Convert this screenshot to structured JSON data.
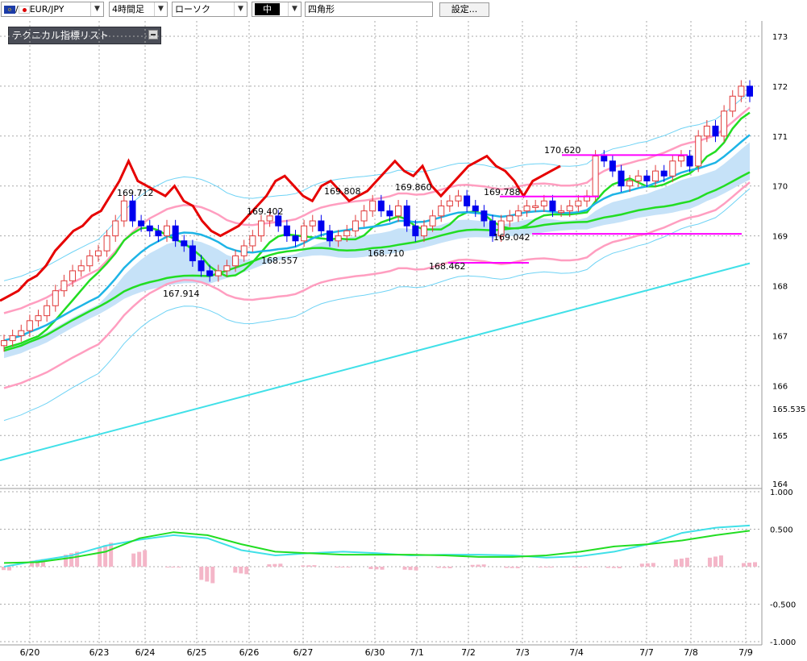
{
  "toolbar": {
    "symbol": "EUR/JPY",
    "timeframe": "4時間足",
    "chart_style": "ローソク",
    "thickness": "中",
    "draw_shape": "四角形",
    "settings_label": "設定..."
  },
  "indicator_panel": {
    "title": "テクニカル指標リスト"
  },
  "price_axis": {
    "labels": [
      "173",
      "172",
      "171",
      "170",
      "169",
      "168",
      "167",
      "166",
      "165.535",
      "165",
      "164"
    ]
  },
  "osc_axis": {
    "labels": [
      "1.000",
      "0.500",
      "-0.500",
      "-1.000"
    ]
  },
  "date_axis": {
    "labels": [
      "6/20",
      "6/23",
      "6/24",
      "6/25",
      "6/26",
      "6/27",
      "6/30",
      "7/1",
      "7/2",
      "7/3",
      "7/4",
      "7/7",
      "7/8",
      "7/9"
    ]
  },
  "annotations": [
    {
      "text": "169.712"
    },
    {
      "text": "169.402"
    },
    {
      "text": "169.808"
    },
    {
      "text": "169.860"
    },
    {
      "text": "169.788"
    },
    {
      "text": "170.620"
    },
    {
      "text": "167.914"
    },
    {
      "text": "168.557"
    },
    {
      "text": "168.710"
    },
    {
      "text": "168.462"
    },
    {
      "text": "169.042"
    }
  ],
  "colors": {
    "up_candle": "#e03a3a",
    "down_candle": "#0000ee",
    "red_line": "#e60000",
    "green_line": "#22dd22",
    "blue_line": "#1eb4e6",
    "pink_line": "#ff9ec0",
    "cyan_line": "#40e0e8",
    "cloud": "#c6e2f8",
    "magenta_line": "#ff00ff",
    "histogram": "#f4b6c8"
  },
  "chart_data": {
    "type": "candlestick",
    "title": "EUR/JPY 4時間足",
    "x_labels": [
      "6/20",
      "6/23",
      "6/24",
      "6/25",
      "6/26",
      "6/27",
      "6/30",
      "7/1",
      "7/2",
      "7/3",
      "7/4",
      "7/7",
      "7/8",
      "7/9"
    ],
    "ylim": [
      164,
      173
    ],
    "closes": [
      166.9,
      167.0,
      167.1,
      167.3,
      167.4,
      167.6,
      167.9,
      168.1,
      168.3,
      168.4,
      168.6,
      168.7,
      169.0,
      169.3,
      169.7,
      169.3,
      169.2,
      169.1,
      169.0,
      169.2,
      168.9,
      168.8,
      168.5,
      168.3,
      168.2,
      168.3,
      168.4,
      168.6,
      168.8,
      169.0,
      169.3,
      169.4,
      169.2,
      169.0,
      168.9,
      169.2,
      169.3,
      169.1,
      168.9,
      169.0,
      169.1,
      169.3,
      169.5,
      169.7,
      169.5,
      169.4,
      169.6,
      169.2,
      169.0,
      169.2,
      169.4,
      169.6,
      169.7,
      169.8,
      169.6,
      169.5,
      169.3,
      169.0,
      169.3,
      169.4,
      169.5,
      169.6,
      169.6,
      169.7,
      169.5,
      169.5,
      169.6,
      169.7,
      169.8,
      170.6,
      170.5,
      170.3,
      170.0,
      170.1,
      170.2,
      170.1,
      170.3,
      170.2,
      170.5,
      170.6,
      170.4,
      171.0,
      171.2,
      171.0,
      171.5,
      171.8,
      172.0,
      171.8
    ],
    "series": [
      {
        "name": "oscillator_line_1",
        "values": [
          0.0,
          0.08,
          0.15,
          0.28,
          0.36,
          0.42,
          0.38,
          0.22,
          0.15,
          0.18,
          0.2,
          0.18,
          0.15,
          0.16,
          0.16,
          0.15,
          0.12,
          0.14,
          0.2,
          0.3,
          0.45,
          0.52,
          0.55
        ]
      },
      {
        "name": "oscillator_line_2",
        "values": [
          0.05,
          0.06,
          0.12,
          0.2,
          0.38,
          0.46,
          0.42,
          0.3,
          0.2,
          0.18,
          0.16,
          0.16,
          0.16,
          0.15,
          0.13,
          0.13,
          0.15,
          0.2,
          0.27,
          0.3,
          0.35,
          0.42,
          0.48
        ]
      },
      {
        "name": "oscillator_histogram",
        "values": [
          -0.05,
          0.1,
          0.2,
          0.32,
          0.22,
          0.0,
          -0.22,
          -0.1,
          0.04,
          0.02,
          0.0,
          -0.04,
          -0.05,
          -0.02,
          0.03,
          -0.02,
          0.0,
          0.0,
          -0.02,
          0.05,
          0.12,
          0.15,
          0.06
        ]
      }
    ]
  }
}
